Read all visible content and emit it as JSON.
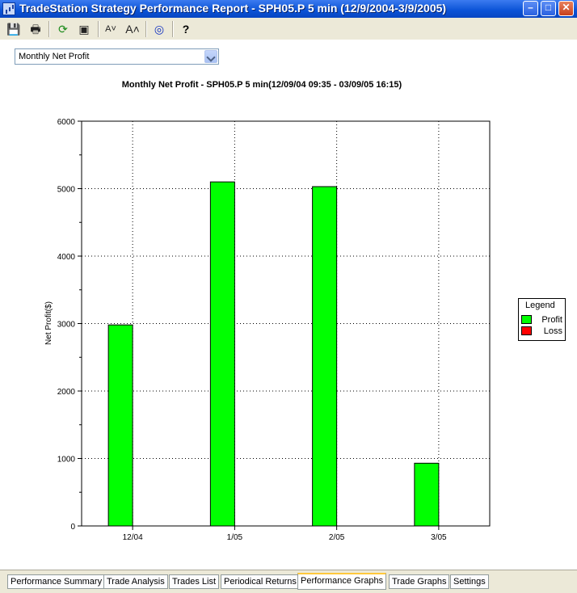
{
  "window": {
    "title": "TradeStation Strategy Performance Report - SPH05.P 5 min (12/9/2004-3/9/2005)",
    "min_glyph": "–",
    "max_glyph": "□",
    "close_glyph": "✕"
  },
  "toolbar": {
    "items": [
      {
        "name": "save-icon",
        "glyph": "💾"
      },
      {
        "name": "print-icon",
        "glyph": "🖶"
      },
      {
        "name": "refresh-icon",
        "glyph": "⟳"
      },
      {
        "name": "properties-icon",
        "glyph": "▣"
      },
      {
        "name": "decrease-font-icon",
        "glyph": "A˅"
      },
      {
        "name": "increase-font-icon",
        "glyph": "A˄"
      },
      {
        "name": "target-icon",
        "glyph": "◎"
      },
      {
        "name": "help-icon",
        "glyph": "?"
      }
    ]
  },
  "graph_selector": {
    "value": "Monthly Net Profit"
  },
  "legend": {
    "title": "Legend",
    "items": [
      {
        "label": "Profit",
        "color": "#00ff00"
      },
      {
        "label": "Loss",
        "color": "#ff0000"
      }
    ]
  },
  "chart_data": {
    "type": "bar",
    "title": "Monthly Net Profit - SPH05.P 5 min(12/09/04 09:35 - 03/09/05 16:15)",
    "ylabel": "Net Profit($)",
    "xlabel": "",
    "categories": [
      "12/04",
      "1/05",
      "2/05",
      "3/05"
    ],
    "values": [
      2980,
      5100,
      5030,
      930
    ],
    "ylim": [
      0,
      6000
    ],
    "yticks": [
      0,
      1000,
      2000,
      3000,
      4000,
      5000,
      6000
    ],
    "profit_color": "#00ff00",
    "loss_color": "#ff0000",
    "grid": "dotted"
  },
  "tabs": [
    {
      "label": "Performance Summary",
      "active": false
    },
    {
      "label": "Trade Analysis",
      "active": false
    },
    {
      "label": "Trades List",
      "active": false
    },
    {
      "label": "Periodical Returns",
      "active": false
    },
    {
      "label": "Performance Graphs",
      "active": true
    },
    {
      "label": "Trade Graphs",
      "active": false
    },
    {
      "label": "Settings",
      "active": false
    }
  ]
}
